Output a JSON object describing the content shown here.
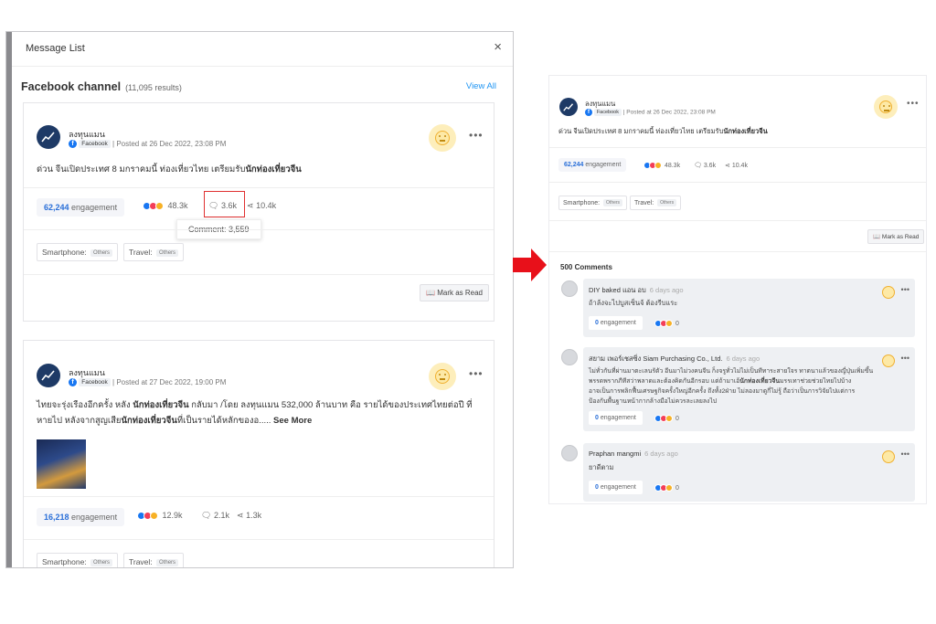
{
  "modal": {
    "title": "Message List",
    "close_icon": "×",
    "channel_title": "Facebook channel",
    "channel_count": "(11,095 results)",
    "view_all": "View All"
  },
  "posts": [
    {
      "author": "ลงทุนแมน",
      "platform": "Facebook",
      "posted": "| Posted at 26 Dec 2022, 23:08 PM",
      "text_plain": "ด่วน จีนเปิดประเทศ 8 มกราคมนี้ ท่องเที่ยวไทย เตรียมรับ",
      "text_bold": "นักท่องเที่ยวจีน",
      "engagement_num": "62,244",
      "engagement_label": "engagement",
      "reactions": "48.3k",
      "comments": "3.6k",
      "shares": "10.4k",
      "tooltip": "Comment: 3,559",
      "tags": [
        {
          "label": "Smartphone:",
          "value": "Others"
        },
        {
          "label": "Travel:",
          "value": "Others"
        }
      ],
      "mark_read": "Mark as Read"
    },
    {
      "author": "ลงทุนแมน",
      "platform": "Facebook",
      "posted": "| Posted at 27 Dec 2022, 19:00 PM",
      "line1_a": "ไทยจะรุ่งเรืองอีกครั้ง หลัง ",
      "line1_b": "นักท่องเที่ยวจีน",
      "line1_c": " กลับมา /โดย ลงทุนแมน 532,000 ล้านบาท คือ รายได้ของประเทศไทยต่อปี ที่",
      "line2_a": "หายไป หลังจากสูญเสีย",
      "line2_b": "นักท่องเที่ยวจีน",
      "line2_c": "ที่เป็นรายได้หลักของอ..... ",
      "see_more": "See More",
      "engagement_num": "16,218",
      "engagement_label": "engagement",
      "reactions": "12.9k",
      "comments": "2.1k",
      "shares": "1.3k",
      "tags": [
        {
          "label": "Smartphone:",
          "value": "Others"
        },
        {
          "label": "Travel:",
          "value": "Others"
        }
      ]
    }
  ],
  "detail": {
    "author": "ลงทุนแมน",
    "platform": "Facebook",
    "posted": "| Posted at 26 Dec 2022, 23:08 PM",
    "text_plain": "ด่วน จีนเปิดประเทศ 8 มกราคมนี้ ท่องเที่ยวไทย เตรียมรับ",
    "text_bold": "นักท่องเที่ยวจีน",
    "engagement_num": "62,244",
    "engagement_label": "engagement",
    "reactions": "48.3k",
    "comments": "3.6k",
    "shares": "10.4k",
    "tags": [
      {
        "label": "Smartphone:",
        "value": "Others"
      },
      {
        "label": "Travel:",
        "value": "Others"
      }
    ],
    "mark_read": "Mark as Read",
    "comments_title": "500 Comments",
    "comment_list": [
      {
        "name": "DIY baked แอน อบ",
        "ago": "6 days ago",
        "text": "ถ้าล้งจะไปบูสเซ็นจ้ ต้องรีบแระ",
        "eng_num": "0",
        "eng_label": "engagement",
        "reacts": "0"
      },
      {
        "name": "สยาม เพอร์เชสซิ่ง Siam Purchasing Co., Ltd.",
        "ago": "6 days ago",
        "l1": "ไม่ทั่วกันที่ผ่านมาตะเลนรัตัว อีนมาไม่วงคนจีน ก็งจรูทั่วไม่ไม่เป็นทีทาระสายใจร ทาตนาแล้วของญี่ปุ่นเพิ่มขึ้น",
        "l2a": "พรรดพรากภีทีสว่าพลาดและต้องคิดกันอีกรอบ แต่ถ้ามาเอ้",
        "l2b": "นักท่องเที่ยวจีน",
        "l2c": "มรรเทาช่วยช่วยไทยไปบ้าง",
        "l3": "อาจเป็นการพลิกฟื้นเศรษฐกิจครั้งใหญ่อีกครั้ง ถึงทั้ง2ฝ่าย ไม่ลองมาดูกี่ไม่รู้ ถือว่าเป็นการวิจัยไปแต่การ",
        "l4": "ป้องกันพื้นฐานหน้ากากล้างมือไม่ควรละเลยลงไป",
        "eng_num": "0",
        "eng_label": "engagement",
        "reacts": "0"
      },
      {
        "name": "Praphan mangmi",
        "ago": "6 days ago",
        "text": "ยาดีตาม",
        "eng_num": "0",
        "eng_label": "engagement",
        "reacts": "0"
      }
    ]
  },
  "colors": {
    "accent": "#2196f3",
    "arrow": "#e8101a",
    "highlight": "#e03030",
    "facebook": "#1877f2"
  }
}
